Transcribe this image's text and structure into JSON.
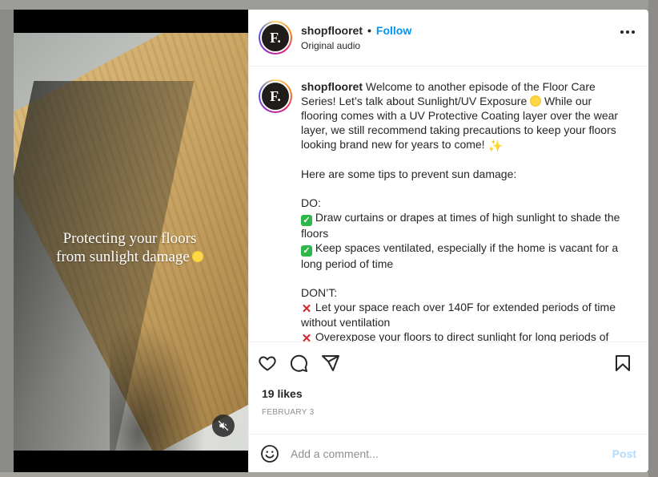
{
  "post": {
    "username": "shopflooret",
    "follow_label": "Follow",
    "dot": "•",
    "audio": "Original audio",
    "avatar_letter": "F.",
    "media_caption_line1": "Protecting your floors",
    "media_caption_line2": "from sunlight damage",
    "caption": {
      "p1_a": "Welcome to another episode of the Floor Care Series! Let’s talk about Sunlight/UV Exposure ",
      "p1_b": " While our flooring comes with a UV Protective Coating layer over the wear layer, we still recommend taking precautions to keep your floors looking brand new for years to come! ",
      "p2": "Here are some tips to prevent sun damage:",
      "do_heading": "DO:",
      "do_items": [
        "Draw curtains or drapes at times of high sunlight to shade the floors",
        "Keep spaces ventilated, especially if the home is vacant for a long period of time"
      ],
      "dont_heading": "DON’T:",
      "dont_items": [
        "Let your space reach over 140F for extended periods of time without ventilation",
        "Overexpose your floors to direct sunlight for long periods of"
      ]
    },
    "likes": "19 likes",
    "date": "FEBRUARY 3",
    "comment_placeholder": "Add a comment...",
    "post_label": "Post"
  },
  "icons": {
    "more": "more-options-icon",
    "like": "heart-icon",
    "comment": "comment-icon",
    "share": "send-icon",
    "save": "bookmark-icon",
    "emoji": "smiley-icon",
    "mute": "speaker-muted-icon"
  },
  "colors": {
    "follow": "#0095f6",
    "post_disabled": "#b3dbff",
    "muted_text": "#8e8e8e"
  }
}
